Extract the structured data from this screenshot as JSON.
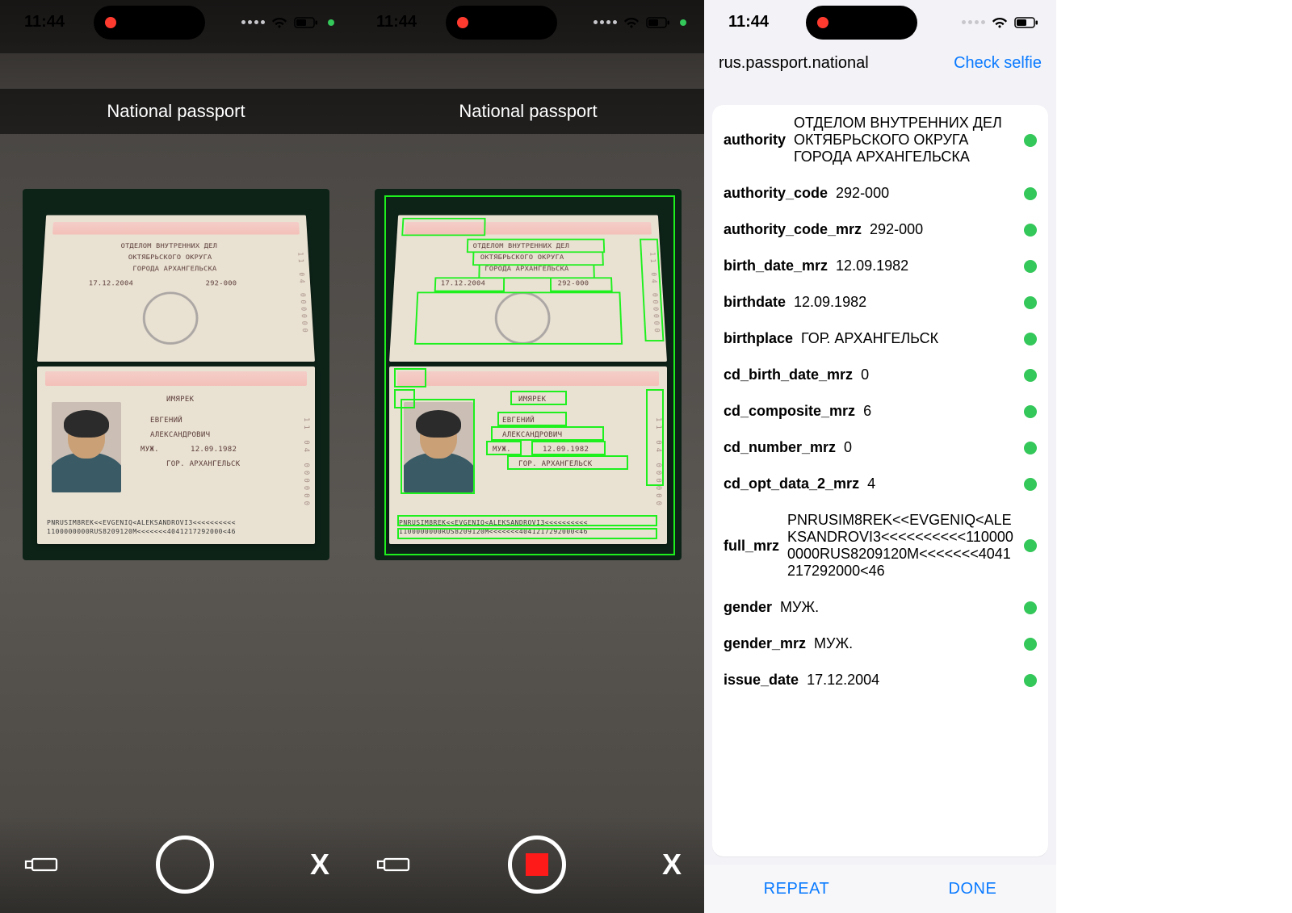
{
  "status": {
    "time": "11:44"
  },
  "camera": {
    "title": "National passport",
    "doc": {
      "authority_l1": "ОТДЕЛОМ ВНУТРЕННИХ ДЕЛ",
      "authority_l2": "ОКТЯБРЬСКОГО ОКРУГА",
      "authority_l3": "ГОРОДА АРХАНГЕЛЬСКА",
      "issue_date": "17.12.2004",
      "authority_code": "292-000",
      "surname": "ИМЯРЕК",
      "first_name": "ЕВГЕНИЙ",
      "patronymic": "АЛЕКСАНДРОВИЧ",
      "gender": "МУЖ.",
      "birthdate": "12.09.1982",
      "birthplace": "ГОР. АРХАНГЕЛЬСК",
      "series_col": "11 04 000000",
      "mrz1": "PNRUSIM8REK<<EVGENIQ<ALEKSANDROVI3<<<<<<<<<<",
      "mrz2": "1100000000RUS8209120M<<<<<<<4041217292000<46"
    }
  },
  "results": {
    "doc_id": "rus.passport.national",
    "selfie_link": "Check selfie",
    "actions": {
      "repeat": "REPEAT",
      "done": "DONE"
    },
    "fields": [
      {
        "key": "authority",
        "value": "ОТДЕЛОМ ВНУТРЕННИХ ДЕЛ ОКТЯБРЬСКОГО ОКРУГА ГОРОДА АРХАНГЕЛЬСКА",
        "ok": true
      },
      {
        "key": "authority_code",
        "value": "292-000",
        "ok": true
      },
      {
        "key": "authority_code_mrz",
        "value": "292-000",
        "ok": true
      },
      {
        "key": "birth_date_mrz",
        "value": "12.09.1982",
        "ok": true
      },
      {
        "key": "birthdate",
        "value": "12.09.1982",
        "ok": true
      },
      {
        "key": "birthplace",
        "value": "ГОР. АРХАНГЕЛЬСК",
        "ok": true
      },
      {
        "key": "cd_birth_date_mrz",
        "value": "0",
        "ok": true
      },
      {
        "key": "cd_composite_mrz",
        "value": "6",
        "ok": true
      },
      {
        "key": "cd_number_mrz",
        "value": "0",
        "ok": true
      },
      {
        "key": "cd_opt_data_2_mrz",
        "value": "4",
        "ok": true
      },
      {
        "key": "full_mrz",
        "value": "PNRUSIM8REK<<EVGENIQ<ALEKSANDROVI3<<<<<<<<<<1100000000RUS8209120M<<<<<<<4041217292000<46",
        "ok": true
      },
      {
        "key": "gender",
        "value": "МУЖ.",
        "ok": true
      },
      {
        "key": "gender_mrz",
        "value": "МУЖ.",
        "ok": true
      },
      {
        "key": "issue_date",
        "value": "17.12.2004",
        "ok": true
      }
    ]
  }
}
